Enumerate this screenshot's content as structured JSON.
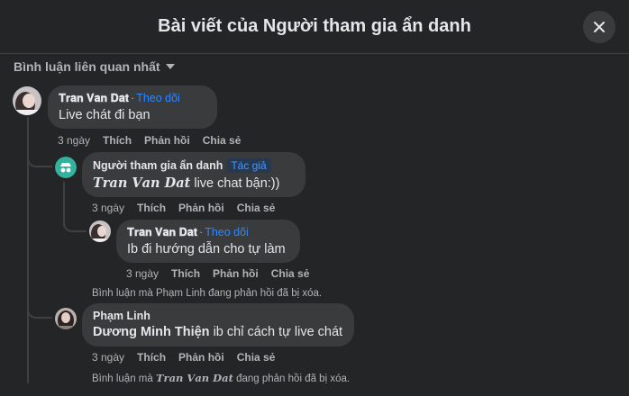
{
  "header": {
    "title": "Bài viết của Người tham gia ẩn danh"
  },
  "sort": {
    "label": "Bình luận liên quan nhất"
  },
  "comments": [
    {
      "author": "𝐓𝐫𝐚𝐧 𝐕𝐚𝐧 𝐃𝐚𝐭",
      "follow": "Theo dõi",
      "text": "Live chát đi bạn",
      "time": "3 ngày",
      "like": "Thích",
      "reply": "Phản hồi",
      "share": "Chia sẻ"
    },
    {
      "author": "Người tham gia ẩn danh",
      "badge": "Tác giả",
      "mention": "𝑻𝒓𝒂𝒏 𝑽𝒂𝒏 𝑫𝒂𝒕",
      "text": "live chat bận:))",
      "time": "3 ngày",
      "like": "Thích",
      "reply": "Phản hồi",
      "share": "Chia sẻ"
    },
    {
      "author": "𝐓𝐫𝐚𝐧 𝐕𝐚𝐧 𝐃𝐚𝐭",
      "follow": "Theo dõi",
      "text": "Ib đi hướng dẫn cho tự làm",
      "time": "3 ngày",
      "like": "Thích",
      "reply": "Phản hồi",
      "share": "Chia sẻ"
    },
    {
      "author": "Phạm Linh",
      "mention": "Dương Minh Thiện",
      "text": "ib chỉ cách tự live chát",
      "time": "3 ngày",
      "like": "Thích",
      "reply": "Phản hồi",
      "share": "Chia sẻ"
    }
  ],
  "notices": {
    "first": "Bình luận mà Phạm Linh đang phản hồi đã bị xóa.",
    "second_prefix": "Bình luận mà",
    "second_name": "𝑻𝒓𝒂𝒏 𝑽𝒂𝒏 𝑫𝒂𝒕",
    "second_suffix": "đang phản hồi đã bị xóa."
  },
  "colors": {
    "background": "#242526",
    "bubble": "#3a3b3c",
    "link": "#2d88ff",
    "muted": "#b0b3b8"
  },
  "icons": {
    "close": "close-icon",
    "sort": "caret-down-icon",
    "anonymous": "anonymous-avatar-icon"
  }
}
